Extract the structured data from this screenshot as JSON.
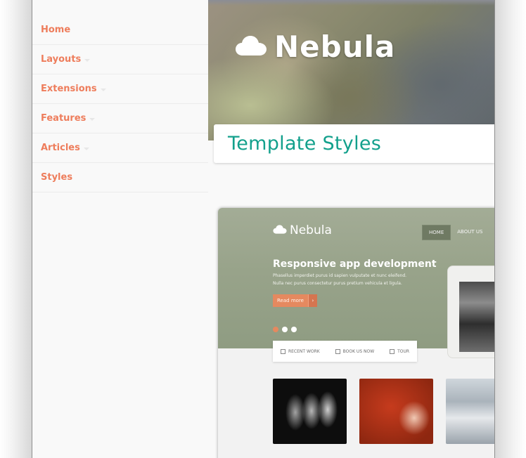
{
  "sidebar": {
    "items": [
      {
        "label": "Home",
        "has_caret": false
      },
      {
        "label": "Layouts",
        "has_caret": true
      },
      {
        "label": "Extensions",
        "has_caret": true
      },
      {
        "label": "Features",
        "has_caret": true
      },
      {
        "label": "Articles",
        "has_caret": true
      },
      {
        "label": "Styles",
        "has_caret": false
      }
    ]
  },
  "header": {
    "logo_icon": "cloud-icon",
    "site_title": "Nebula"
  },
  "page": {
    "title": "Template Styles"
  },
  "preview": {
    "logo_icon": "cloud-icon",
    "site_title": "Nebula",
    "nav": [
      "HOME",
      "ABOUT US"
    ],
    "heading": "Responsive app development",
    "text_lines": [
      "Phasellus imperdiet purus id sapien vulputate et nunc eleifend.",
      "Nulla nec purus consectetur purus pretium vehicula et ligula."
    ],
    "button_label": "Read more",
    "button_arrow": "›",
    "tabs": [
      "RECENT WORK",
      "BOOK US NOW",
      "TOUR"
    ]
  },
  "colors": {
    "nav_text": "#ee7d5c",
    "title_text": "#13a08c",
    "accent": "#e5895f"
  }
}
